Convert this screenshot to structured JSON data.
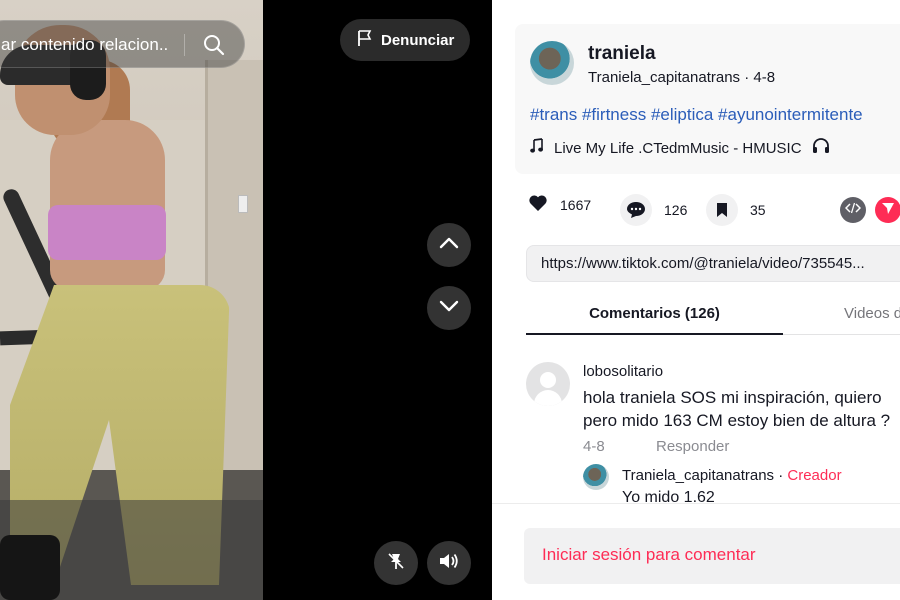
{
  "search": {
    "text": "ar contenido relacion..."
  },
  "report_button": {
    "label": "Denunciar"
  },
  "author": {
    "name": "traniela",
    "handle": "Traniela_capitanatrans",
    "date": "4-8"
  },
  "description": {
    "hashtags": "#trans #firtness #eliptica #ayunointermitente"
  },
  "music": {
    "title": "Live My Life .CTedmMusic - HMUSIC"
  },
  "stats": {
    "likes": "1667",
    "comments": "126",
    "saves": "35"
  },
  "link": {
    "url": "https://www.tiktok.com/@traniela/video/735545..."
  },
  "tabs": {
    "comments_label": "Comentarios (126)",
    "videos_label": "Videos d"
  },
  "comment": {
    "user": "lobosolitario",
    "text_line1": "hola traniela SOS mi inspiración, quiero",
    "text_line2": "pero mido 163 CM estoy bien de altura ?",
    "date": "4-8",
    "reply_label": "Responder"
  },
  "reply": {
    "user": "Traniela_capitanatrans",
    "separator": " · ",
    "badge": "Creador",
    "text": "Yo mido 1.62"
  },
  "footer": {
    "login_label": "Iniciar sesión para comentar"
  },
  "colors": {
    "accent": "#fe2c55",
    "hashtag": "#2b5db9"
  },
  "icons": [
    "search-icon",
    "flag-icon",
    "chevron-up-icon",
    "chevron-down-icon",
    "float-player-icon",
    "volume-icon",
    "music-note-icon",
    "headphones-icon",
    "heart-icon",
    "comment-icon",
    "bookmark-icon",
    "embed-icon",
    "send-icon"
  ]
}
